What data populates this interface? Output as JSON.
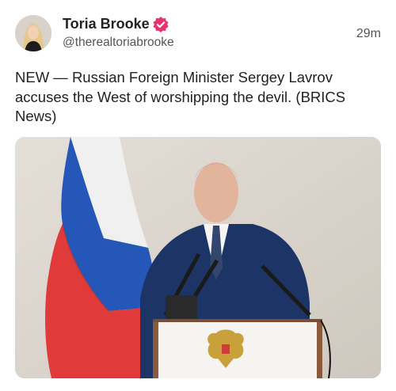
{
  "author": {
    "name": "Toria Brooke",
    "handle": "@therealtoriabrooke",
    "avatar_icon": "profile-photo",
    "verified_icon": "verified-badge-icon",
    "verified_color": "#e8336d"
  },
  "post": {
    "time": "29m",
    "text": "NEW — Russian Foreign Minister Sergey Lavrov accuses the West of worshipping the devil. (BRICS News)"
  },
  "media": {
    "kind": "photo",
    "colors": {
      "wall": "#d9d3cb",
      "flag_white": "#f2f2f2",
      "flag_blue": "#2557b8",
      "flag_red": "#e03a3a",
      "suit": "#1d3566",
      "podium": "#f6f4f1",
      "wood": "#8b5a3c"
    }
  }
}
